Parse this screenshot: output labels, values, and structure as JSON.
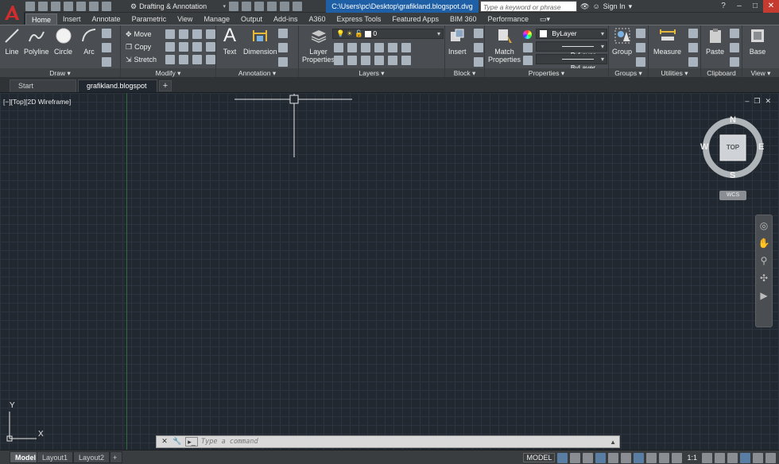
{
  "app": {
    "workspace": "Drafting & Annotation",
    "doc_path": "C:\\Users\\pc\\Desktop\\grafikland.blogspot.dvg",
    "search_placeholder": "Type a keyword or phrase",
    "signin": "Sign In"
  },
  "ribbon_tabs": [
    "Home",
    "Insert",
    "Annotate",
    "Parametric",
    "View",
    "Manage",
    "Output",
    "Add-ins",
    "A360",
    "Express Tools",
    "Featured Apps",
    "BIM 360",
    "Performance"
  ],
  "draw": {
    "line": "Line",
    "polyline": "Polyline",
    "circle": "Circle",
    "arc": "Arc",
    "label": "Draw"
  },
  "modify": {
    "move": "Move",
    "copy": "Copy",
    "stretch": "Stretch",
    "label": "Modify"
  },
  "annotation": {
    "text": "Text",
    "dimension": "Dimension",
    "label": "Annotation"
  },
  "layers": {
    "layer_properties_1": "Layer",
    "layer_properties_2": "Properties",
    "current_layer": "0",
    "label": "Layers"
  },
  "block": {
    "insert": "Insert",
    "label": "Block"
  },
  "properties": {
    "match_1": "Match",
    "match_2": "Properties",
    "color": "ByLayer",
    "linetype": "ByLayer",
    "lineweight": "ByLayer",
    "label": "Properties"
  },
  "groups": {
    "group": "Group",
    "label": "Groups"
  },
  "utilities": {
    "measure": "Measure",
    "label": "Utilities"
  },
  "clipboard": {
    "paste": "Paste",
    "label": "Clipboard"
  },
  "view_panel": {
    "base": "Base",
    "label": "View"
  },
  "doc_tabs": {
    "start": "Start",
    "active": "grafikland.blogspot",
    "add": "+"
  },
  "viewport": {
    "label": "[−][Top][2D Wireframe]",
    "wcs": "WCS",
    "cube_top": "TOP",
    "n": "N",
    "s": "S",
    "e": "E",
    "w": "W",
    "y": "Y",
    "x": "X"
  },
  "command": {
    "placeholder": "Type a command"
  },
  "layout_tabs": [
    "Model",
    "Layout1",
    "Layout2"
  ],
  "status": {
    "model": "MODEL",
    "scale": "1:1"
  },
  "colors": {
    "accent": "#1f5fa6",
    "canvas": "#212830",
    "ribbon": "#4a4e52"
  }
}
